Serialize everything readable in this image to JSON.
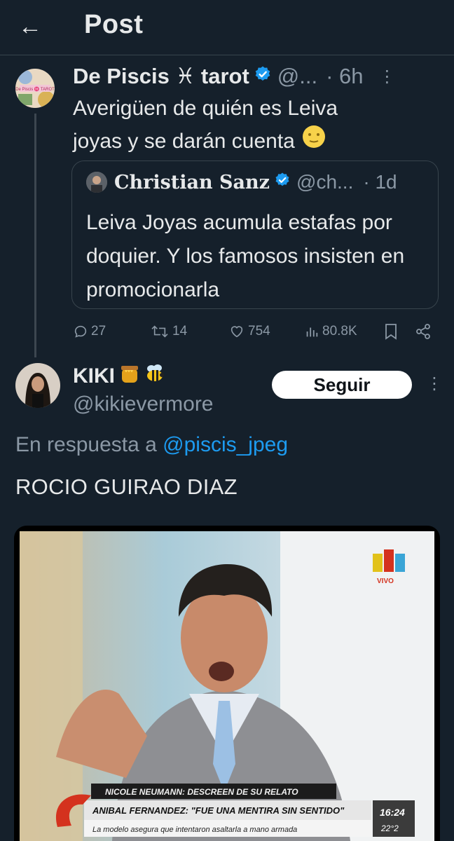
{
  "header": {
    "back_icon": "←",
    "title": "Post"
  },
  "parent_tweet": {
    "display_name": "De Piscis ♓ tarot",
    "handle": "@...",
    "time": "· 6h",
    "text_line1": "Averigüen de quién es Leiva",
    "text_line2": "joyas y se darán cuenta",
    "avatar_text": "De Piscis ♓ TAROT",
    "quote": {
      "display_name": "Christian Sanz",
      "handle": "@ch...",
      "time": "· 1d",
      "text": "Leiva Joyas acumula estafas por doquier. Y los famosos insisten en promocionarla"
    },
    "actions": {
      "replies": "27",
      "retweets": "14",
      "likes": "754",
      "views": "80.8K"
    }
  },
  "reply_tweet": {
    "display_name": "KIKI",
    "handle": "@kikievermore",
    "follow_label": "Seguir",
    "reply_prefix": "En respuesta a",
    "reply_handle": "@piscis_jpeg",
    "text": "ROCIO GUIRAO DIAZ",
    "media": {
      "channel_tag": "VIVO",
      "ticker_top": "NICOLE NEUMANN: DESCREEN DE SU RELATO",
      "ticker_main": "ANIBAL FERNANDEZ: \"FUE UNA MENTIRA SIN SENTIDO\"",
      "ticker_sub": "La modelo asegura que intentaron asaltarla a mano armada",
      "clock": "16:24",
      "temp": "22°2"
    }
  },
  "colors": {
    "bg": "#15202b",
    "accent": "#1d9bf0",
    "muted": "#8b98a5"
  }
}
